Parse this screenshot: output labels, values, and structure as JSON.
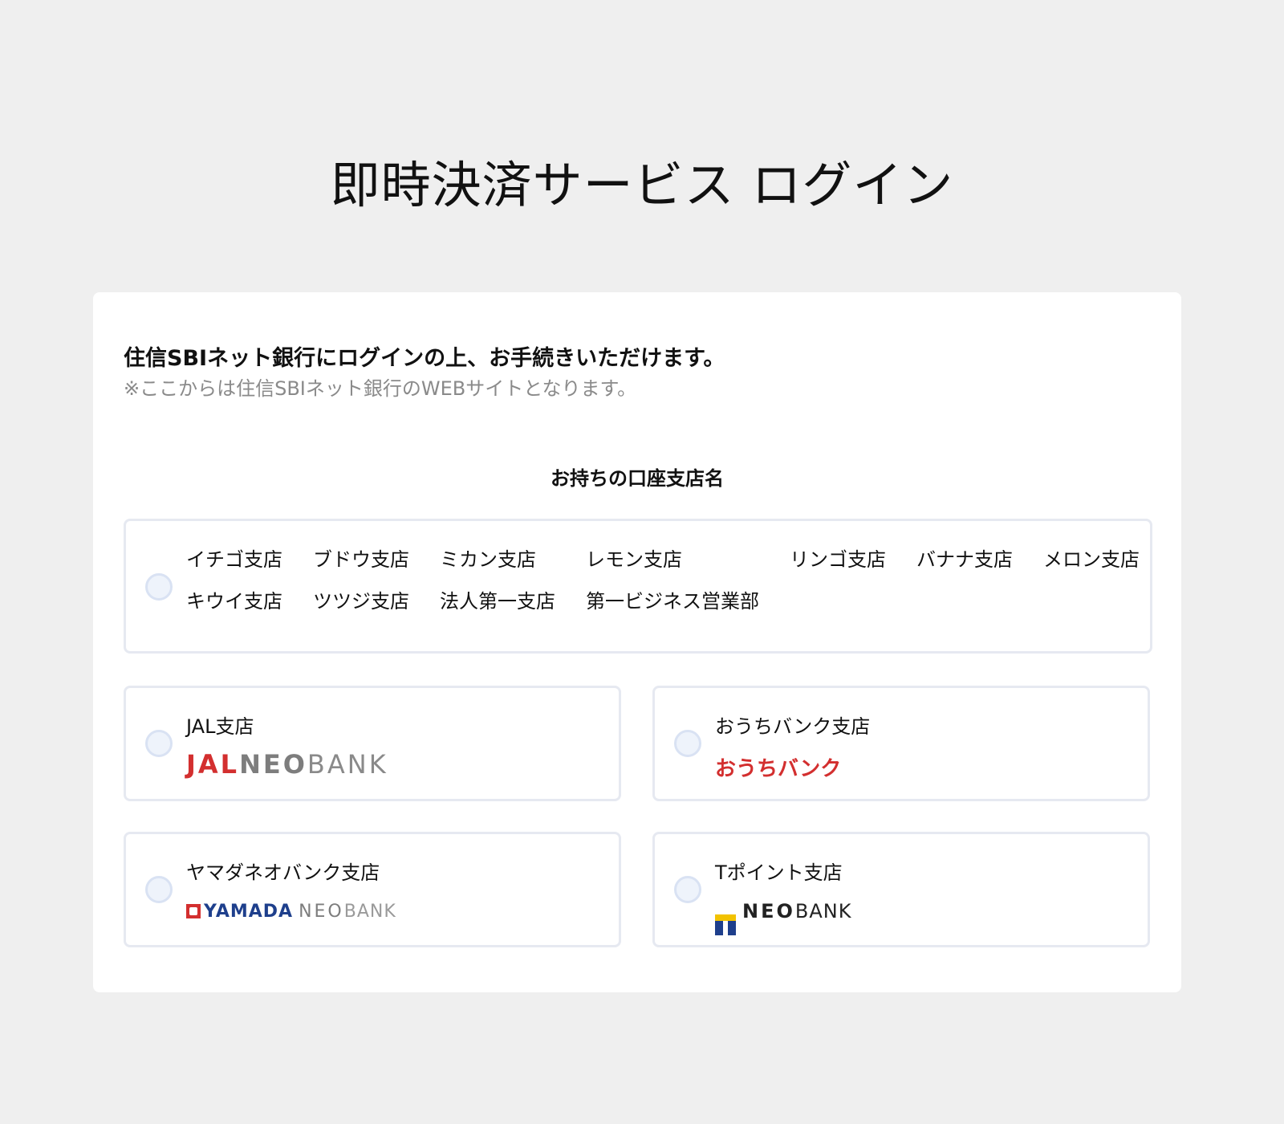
{
  "page": {
    "title": "即時決済サービス ログイン"
  },
  "intro": {
    "main": "住信SBIネット銀行にログインの上、お手続きいただけます。",
    "note": "※ここからは住信SBIネット銀行のWEBサイトとなります。"
  },
  "section_label": "お持ちの口座支店名",
  "main_option": {
    "branches": [
      "イチゴ支店",
      "ブドウ支店",
      "ミカン支店",
      "レモン支店",
      "リンゴ支店",
      "バナナ支店",
      "メロン支店",
      "キウイ支店",
      "ツツジ支店",
      "法人第一支店",
      "第一ビジネス営業部"
    ]
  },
  "options": {
    "jal": {
      "label": "JAL支店",
      "logo": {
        "jal": "JAL",
        "neo": "NEO",
        "bank": "BANK"
      }
    },
    "ouchi": {
      "label": "おうちバンク支店",
      "logo": {
        "text": "おうちバンク"
      }
    },
    "yamada": {
      "label": "ヤマダネオバンク支店",
      "logo": {
        "yamada": "YAMADA",
        "neo": "NEO",
        "bank": "BANK"
      }
    },
    "tpoint": {
      "label": "Tポイント支店",
      "logo": {
        "neo": "NEO",
        "bank": "BANK"
      }
    }
  },
  "colors": {
    "background": "#efefef",
    "card": "#ffffff",
    "border": "#e6e9f1",
    "radio": "#d9e2f3",
    "brand_red": "#d32f2f",
    "brand_blue": "#1e3f8c"
  }
}
